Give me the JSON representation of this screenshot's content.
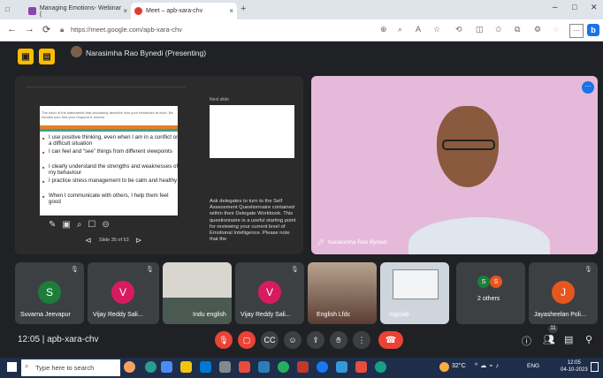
{
  "browser": {
    "tabs": [
      {
        "title": "Managing Emotions- Webinar (",
        "active": false
      },
      {
        "title": "Meet – apb-xara-chv",
        "active": true
      }
    ],
    "url": "https://meet.google.com/apb-xara-chv"
  },
  "meet": {
    "presenting_label": "Narasimha Rao Bynedi (Presenting)",
    "main_speaker": "Narasimha Rao Bynedi",
    "shared_slide": {
      "header_text": "The each of the statements that accurately describe how your behaviors at work. Be mindful your first your respond & honest",
      "bullets": [
        "I use positive thinking, even when I am in a conflict or a difficult situation",
        "I can feel and “see” things from different viewpoints",
        "I clearly understand the strengths and weaknesses of my behaviour",
        "I practice stress management to be calm and healthy",
        "When I communicate with others, I help them feel good"
      ],
      "slide_counter": "Slide 35 of 53",
      "notes_label": "Next slide",
      "notes_text": "Ask delegates to turn to the Self Assessment Questionnaire contained within their Delegate Workbook. This questionnaire is a useful starting point for reviewing your current level of Emotional Intelligence. Please note that the"
    },
    "participants": [
      {
        "name": "Suvarna Jeevapur",
        "initial": "S",
        "color": "#1e7d3b",
        "type": "avatar"
      },
      {
        "name": "Vijay Reddy Sali...",
        "initial": "V",
        "color": "#d81b60",
        "type": "avatar"
      },
      {
        "name": "Indu english",
        "type": "video"
      },
      {
        "name": "Vijay Reddy Sali...",
        "initial": "V",
        "color": "#d81b60",
        "type": "avatar"
      },
      {
        "name": "English Lfdc",
        "type": "video"
      },
      {
        "name": "mgclab",
        "type": "video"
      },
      {
        "name": "2 others",
        "type": "others"
      },
      {
        "name": "Jayasheelan Poli...",
        "initial": "J",
        "color": "#e8561f",
        "type": "avatar"
      }
    ],
    "others_initials": [
      "S",
      "S"
    ],
    "time": "12:05",
    "meeting_code": "apb-xara-chv",
    "participant_count": "11"
  },
  "taskbar": {
    "search_placeholder": "Type here to search",
    "weather": "32°C",
    "lang": "ENG",
    "time": "12:05",
    "date": "04-10-2023"
  }
}
